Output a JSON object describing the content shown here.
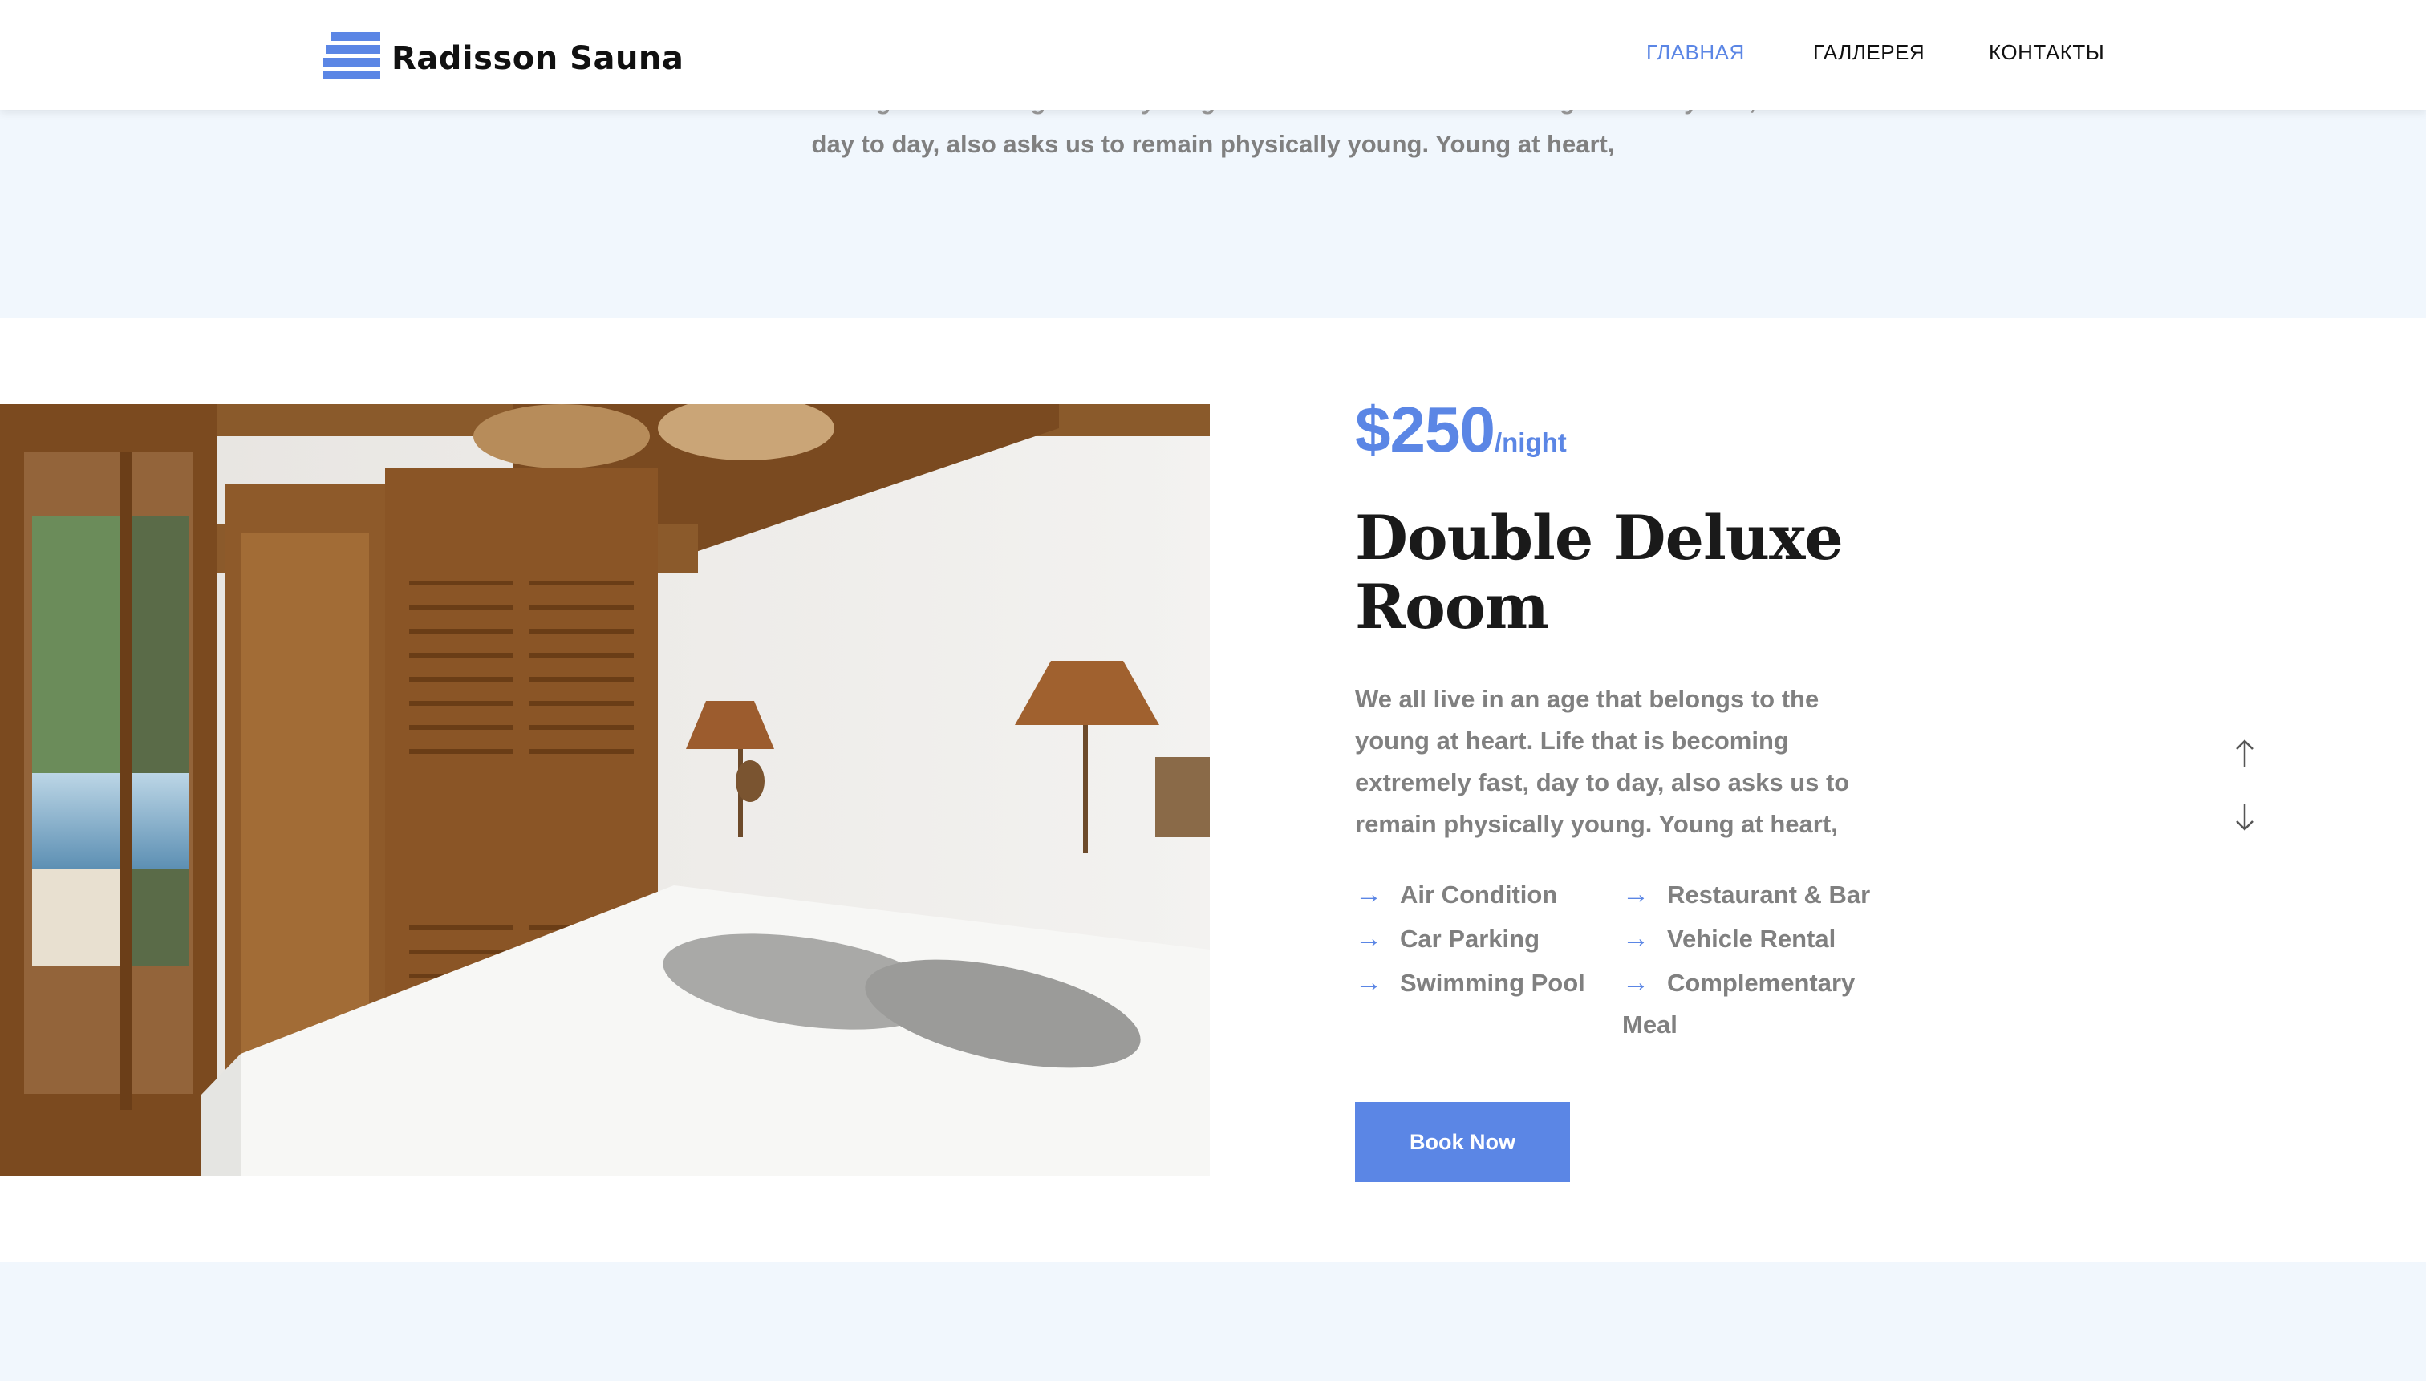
{
  "header": {
    "logo_text": "Radisson Sauna",
    "nav": [
      {
        "label": "ГЛАВНАЯ",
        "active": true
      },
      {
        "label": "ГАЛЛЕРЕЯ",
        "active": false
      },
      {
        "label": "КОНТАКТЫ",
        "active": false
      }
    ]
  },
  "intro": {
    "line1": "We all live in an age that belongs to the young at heart. Life that is becoming extremely fast,",
    "line2": "day to day, also asks us to remain physically young. Young at heart,"
  },
  "room": {
    "price": "$250",
    "price_unit": "/night",
    "title": "Double Deluxe Room",
    "description": "We all live in an age that belongs to the young at heart. Life that is becoming extremely fast, day to day, also asks us to remain physically young. Young at heart,",
    "amenities": [
      "Air Condition",
      "Car Parking",
      "Swimming Pool",
      "Restaurant & Bar",
      "Vehicle Rental",
      "Complementary Meal"
    ],
    "amenity_arrow": "→",
    "book_label": "Book Now"
  },
  "slider": {
    "up_icon": "arrow-up-icon",
    "down_icon": "arrow-down-icon"
  },
  "colors": {
    "accent": "#5b86e5",
    "section_bg": "#f1f7fd",
    "heading": "#1a1a1a",
    "text": "#808080"
  }
}
